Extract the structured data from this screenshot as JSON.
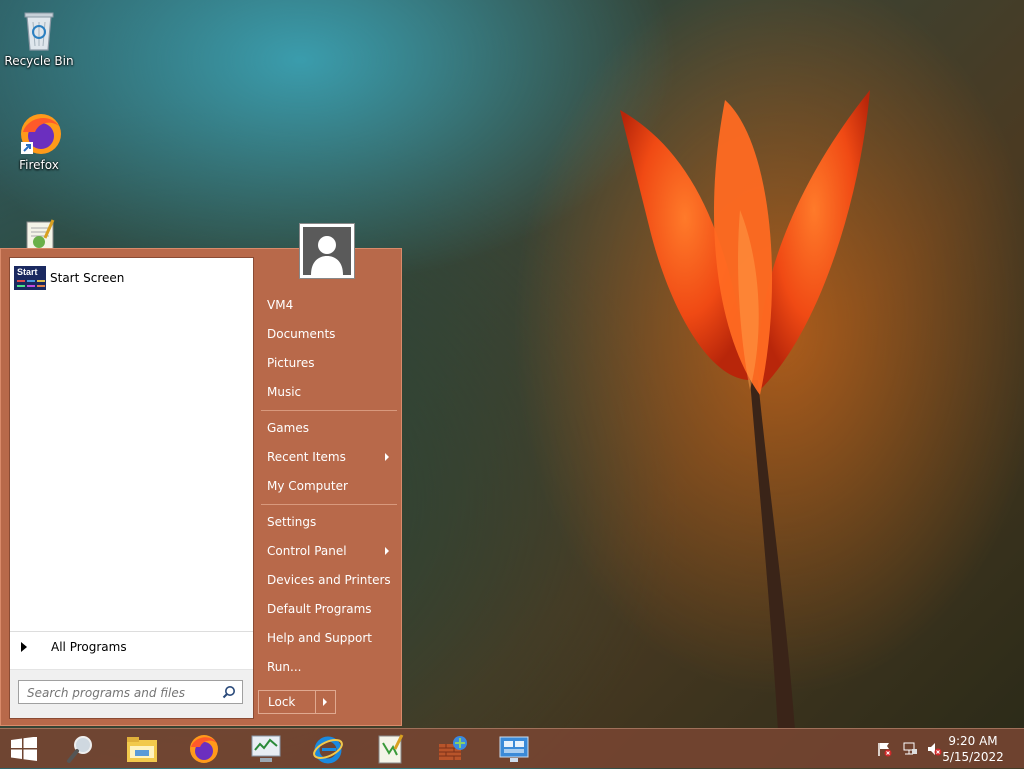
{
  "desktop": {
    "icons": [
      {
        "label": "Recycle Bin",
        "icon": "recycle-bin-icon"
      },
      {
        "label": "Firefox",
        "icon": "firefox-icon"
      },
      {
        "label": "",
        "icon": "notepad-icon"
      }
    ]
  },
  "start_menu": {
    "pinned": [
      {
        "label": "Start Screen",
        "tile_text": "Start"
      }
    ],
    "all_programs_label": "All Programs",
    "search_placeholder": "Search programs and files",
    "right_items": [
      {
        "label": "VM4",
        "submenu": false
      },
      {
        "label": "Documents",
        "submenu": false
      },
      {
        "label": "Pictures",
        "submenu": false
      },
      {
        "label": "Music",
        "submenu": false
      },
      {
        "label": "Games",
        "submenu": false
      },
      {
        "label": "Recent Items",
        "submenu": true
      },
      {
        "label": "My Computer",
        "submenu": false
      },
      {
        "label": "Settings",
        "submenu": false
      },
      {
        "label": "Control Panel",
        "submenu": true
      },
      {
        "label": "Devices and Printers",
        "submenu": false
      },
      {
        "label": "Default Programs",
        "submenu": false
      },
      {
        "label": "Help and Support",
        "submenu": false
      },
      {
        "label": "Run...",
        "submenu": false
      }
    ],
    "lock_label": "Lock"
  },
  "taskbar": {
    "apps": [
      "start-button",
      "search-icon",
      "file-explorer-icon",
      "firefox-icon",
      "task-manager-icon",
      "internet-explorer-icon",
      "notepad-plus-plus-icon",
      "network-setup-icon",
      "remote-desktop-icon"
    ],
    "tray_icons": [
      "action-center-flag-icon",
      "network-icon",
      "volume-muted-icon"
    ],
    "time": "9:20 AM",
    "date": "5/15/2022"
  },
  "colors": {
    "accent": "#b8694a",
    "taskbar": "#7a4632"
  }
}
